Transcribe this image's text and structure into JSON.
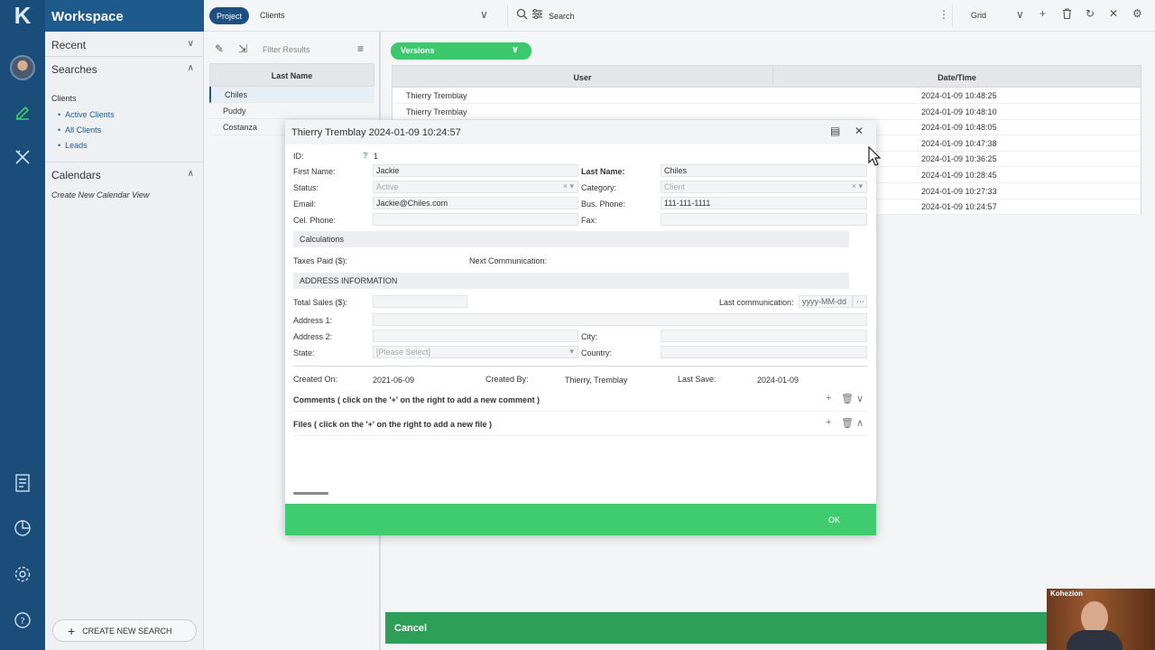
{
  "app": {
    "name": "Workspace",
    "logo_glyph": "K"
  },
  "topbar": {
    "project_tab": "Project",
    "clients_tab": "Clients",
    "search_placeholder": "Search",
    "view_mode": "Grid"
  },
  "nav": {
    "recent": "Recent",
    "searches": "Searches",
    "clients_group": "Clients",
    "client_items": [
      "Active Clients",
      "All Clients",
      "Leads"
    ],
    "calendars": "Calendars",
    "create_calendar": "Create New Calendar View",
    "create_search": "CREATE NEW SEARCH"
  },
  "list": {
    "filter_placeholder": "Filter Results",
    "column": "Last Name",
    "rows": [
      "Chiles",
      "Puddy",
      "Costanza"
    ]
  },
  "versions": {
    "button": "Versions",
    "columns": [
      "User",
      "Date/Time"
    ],
    "rows": [
      {
        "user": "Thierry Tremblay",
        "date": "2024-01-09 10:48:25"
      },
      {
        "user": "Thierry Tremblay",
        "date": "2024-01-09 10:48:10"
      },
      {
        "user": "",
        "date": "2024-01-09 10:48:05"
      },
      {
        "user": "",
        "date": "2024-01-09 10:47:38"
      },
      {
        "user": "",
        "date": "2024-01-09 10:36:25"
      },
      {
        "user": "",
        "date": "2024-01-09 10:28:45"
      },
      {
        "user": "",
        "date": "2024-01-09 10:27:33"
      },
      {
        "user": "",
        "date": "2024-01-09 10:24:57"
      }
    ]
  },
  "dialog": {
    "title": "Thierry Tremblay 2024-01-09 10:24:57",
    "id_label": "ID:",
    "id_value": "1",
    "first_name_label": "First Name:",
    "first_name": "Jackie",
    "last_name_label": "Last Name:",
    "last_name": "Chiles",
    "status_label": "Status:",
    "status": "Active",
    "category_label": "Category:",
    "category": "Client",
    "email_label": "Email:",
    "email": "Jackie@Chiles.com",
    "bus_phone_label": "Bus. Phone:",
    "bus_phone": "111-111-1111",
    "cel_phone_label": "Cel. Phone:",
    "fax_label": "Fax:",
    "calculations": "Calculations",
    "taxes_label": "Taxes Paid ($):",
    "next_comm_label": "Next Communication:",
    "address_section": "ADDRESS INFORMATION",
    "total_sales_label": "Total Sales ($):",
    "last_comm_label": "Last communication:",
    "last_comm_placeholder": "yyyy-MM-dd",
    "address1_label": "Address 1:",
    "address2_label": "Address 2:",
    "city_label": "City:",
    "state_label": "State:",
    "state_placeholder": "[Please Select]",
    "country_label": "Country:",
    "created_on_label": "Created On:",
    "created_on": "2021-06-09",
    "created_by_label": "Created By:",
    "created_by": "Thierry, Tremblay",
    "last_save_label": "Last Save:",
    "last_save": "2024-01-09",
    "comments": "Comments ( click on the '+' on the right to add a new comment )",
    "files": "Files ( click on the '+' on the right to add a new file )",
    "ok": "OK"
  },
  "cancel": "Cancel",
  "webcam": {
    "brand": "Kohezion"
  },
  "colors": {
    "primary": "#1f5a8c",
    "rail": "#1b4d7a",
    "green": "#3ecc6e",
    "cancel_green": "#2e9f58"
  }
}
